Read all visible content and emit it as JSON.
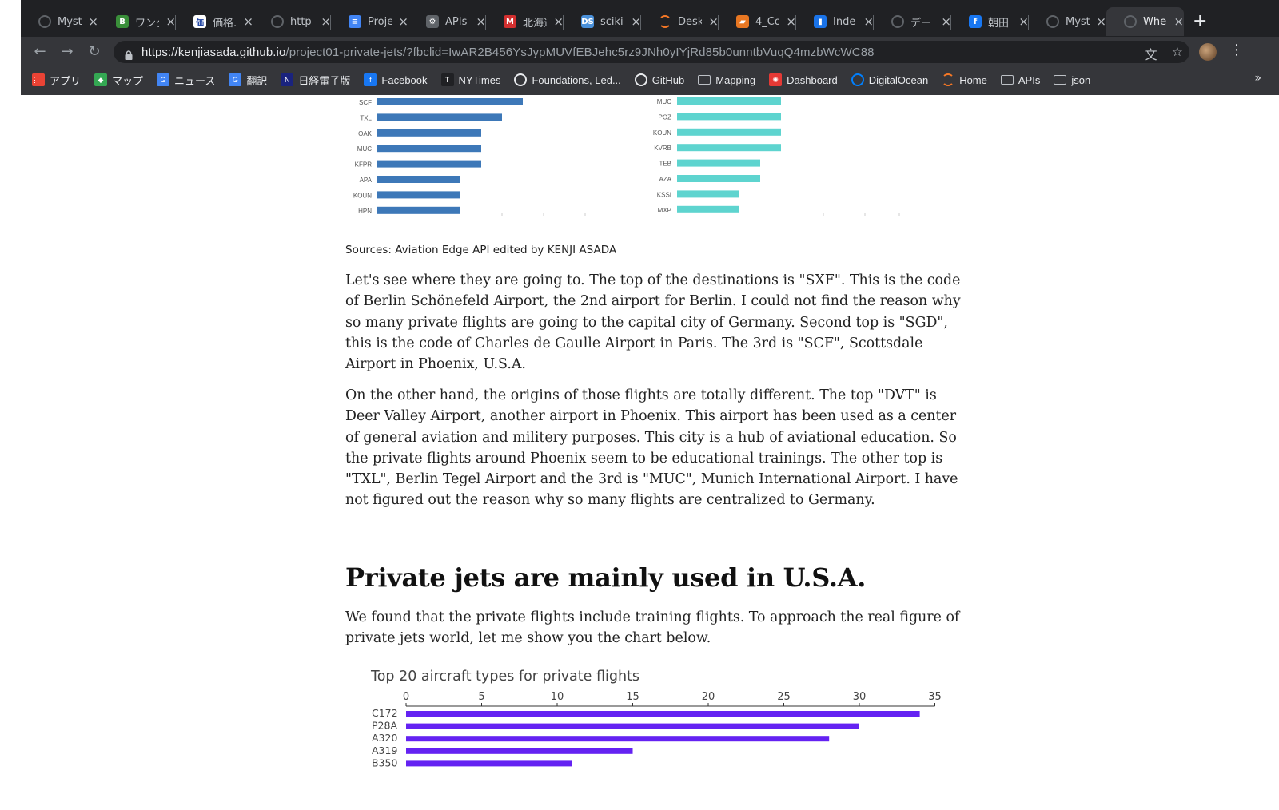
{
  "browser": {
    "tabs": [
      {
        "title": "Myst",
        "icon": "globe-icon",
        "color": "#5f6368",
        "glyph": ""
      },
      {
        "title": "ワンダ",
        "icon": "b-icon",
        "color": "#3a8f3a",
        "glyph": "B"
      },
      {
        "title": "価格.",
        "icon": "kakaku-icon",
        "color": "#ffffff",
        "glyph": "価"
      },
      {
        "title": "http",
        "icon": "globe-icon",
        "color": "#5f6368",
        "glyph": ""
      },
      {
        "title": "Proje",
        "icon": "docs-icon",
        "color": "#4285f4",
        "glyph": "≡"
      },
      {
        "title": "APIs",
        "icon": "gear-icon",
        "color": "#5f6368",
        "glyph": "⚙"
      },
      {
        "title": "北海道",
        "icon": "m-icon",
        "color": "#d32f2f",
        "glyph": "M"
      },
      {
        "title": "sciki",
        "icon": "ds-icon",
        "color": "#4a90d9",
        "glyph": "DS"
      },
      {
        "title": "Desk",
        "icon": "jupyter-icon",
        "color": "#f37726",
        "glyph": ""
      },
      {
        "title": "4_Co",
        "icon": "notebook-icon",
        "color": "#e87722",
        "glyph": "▰"
      },
      {
        "title": "Inde",
        "icon": "chart-icon",
        "color": "#1a73e8",
        "glyph": "▮"
      },
      {
        "title": "デー",
        "icon": "loading-icon",
        "color": "#5f6368",
        "glyph": ""
      },
      {
        "title": "朝田",
        "icon": "facebook-icon",
        "color": "#1877f2",
        "glyph": "f"
      },
      {
        "title": "Myst",
        "icon": "globe-icon",
        "color": "#5f6368",
        "glyph": ""
      },
      {
        "title": "Whe",
        "icon": "globe-icon",
        "color": "#5f6368",
        "glyph": "",
        "active": true
      }
    ],
    "url_host": "https://kenjiasada.github.io",
    "url_path": "/project01-private-jets/?fbclid=IwAR2B456YsJypMUVfEBJehc5rz9JNh0yIYjRd85b0unntbVuqQ4mzbWcWC88",
    "bookmarks": [
      {
        "label": "アプリ",
        "icon": "apps-icon",
        "color": "#ea4335",
        "glyph": "⋮⋮"
      },
      {
        "label": "マップ",
        "icon": "maps-icon",
        "color": "#34a853",
        "glyph": "◆"
      },
      {
        "label": "ニュース",
        "icon": "news-icon",
        "color": "#4285f4",
        "glyph": "G"
      },
      {
        "label": "翻訳",
        "icon": "translate-icon",
        "color": "#4285f4",
        "glyph": "G"
      },
      {
        "label": "日経電子版",
        "icon": "nikkei-icon",
        "color": "#1a237e",
        "glyph": "N"
      },
      {
        "label": "Facebook",
        "icon": "facebook-icon",
        "color": "#1877f2",
        "glyph": "f"
      },
      {
        "label": "NYTimes",
        "icon": "nytimes-icon",
        "color": "#202124",
        "glyph": "T"
      },
      {
        "label": "Foundations, Led...",
        "icon": "globe-icon",
        "color": "#5f6368",
        "glyph": ""
      },
      {
        "label": "GitHub",
        "icon": "github-icon",
        "color": "#202124",
        "glyph": ""
      },
      {
        "label": "Mapping",
        "icon": "folder-icon",
        "folder": true
      },
      {
        "label": "Dashboard",
        "icon": "dashboard-icon",
        "color": "#e53935",
        "glyph": "✺"
      },
      {
        "label": "DigitalOcean",
        "icon": "digitalocean-icon",
        "color": "#0080ff",
        "glyph": ""
      },
      {
        "label": "Home",
        "icon": "jupyter-icon",
        "color": "#f37726",
        "glyph": ""
      },
      {
        "label": "APIs",
        "icon": "folder-icon",
        "folder": true
      },
      {
        "label": "json",
        "icon": "folder-icon",
        "folder": true
      }
    ],
    "bookmarks_more": "»"
  },
  "article": {
    "caption": "Sources: Aviation Edge API edited by KENJI ASADA",
    "paragraph1": "Let's see where they are going to. The top of the destinations is \"SXF\". This is the code of Berlin Schönefeld Airport, the 2nd airport for Berlin. I could not find the reason why so many private flights are going to the capital city of Germany. Second top is \"SGD\", this is the code of Charles de Gaulle Airport in Paris. The 3rd is \"SCF\", Scottsdale Airport in Phoenix, U.S.A.",
    "paragraph2": "On the other hand, the origins of those flights are totally different. The top \"DVT\" is Deer Valley Airport, another airport in Phoenix. This airport has been used as a center of general aviation and militery purposes. This city is a hub of aviational education. So the private flights around Phoenix seem to be educational trainings. The other top is \"TXL\", Berlin Tegel Airport and the 3rd is \"MUC\", Munich International Airport. I have not figured out the reason why so many flights are centralized to Germany.",
    "heading": "Private jets are mainly used in U.S.A.",
    "paragraph3": "We found that the private flights include training flights. To approach the real figure of private jets world, let me show you the chart below."
  },
  "chart_data": [
    {
      "type": "bar",
      "orientation": "horizontal",
      "color": "#3d78b8",
      "categories": [
        "SCF",
        "TXL",
        "OAK",
        "MUC",
        "KFPR",
        "APA",
        "KOUN",
        "HPN"
      ],
      "values": [
        7,
        6,
        5,
        5,
        5,
        4,
        4,
        4
      ],
      "xlim": [
        0,
        10
      ],
      "grid": false
    },
    {
      "type": "bar",
      "orientation": "horizontal",
      "color": "#5ed4cf",
      "categories": [
        "MUC",
        "POZ",
        "KOUN",
        "KVRB",
        "TEB",
        "AZA",
        "KSSI",
        "MXP"
      ],
      "values": [
        5,
        5,
        5,
        5,
        4,
        4,
        3,
        3
      ],
      "xlim": [
        0,
        10
      ],
      "grid": false
    },
    {
      "type": "bar",
      "orientation": "horizontal",
      "title": "Top 20 aircraft types for private flights",
      "color": "#6422f2",
      "categories": [
        "C172",
        "P28A",
        "A320",
        "A319",
        "B350"
      ],
      "values": [
        34,
        30,
        28,
        15,
        11
      ],
      "xticks": [
        0,
        5,
        10,
        15,
        20,
        25,
        30,
        35
      ],
      "xlim": [
        0,
        35
      ],
      "grid": false
    }
  ]
}
